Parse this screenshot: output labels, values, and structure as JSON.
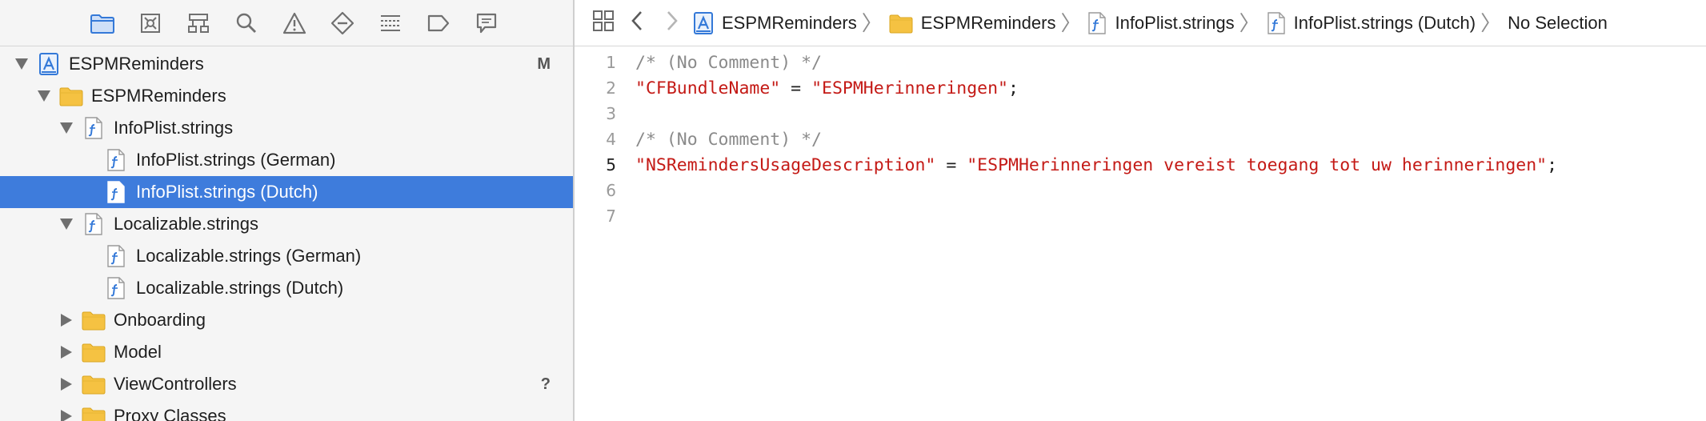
{
  "navigator": {
    "tabs": [
      {
        "name": "project-navigator-tab",
        "icon": "folder-icon",
        "selected": true
      },
      {
        "name": "symbol-navigator-tab",
        "icon": "symbol-icon",
        "selected": false
      },
      {
        "name": "hierarchy-navigator-tab",
        "icon": "hierarchy-icon",
        "selected": false
      },
      {
        "name": "find-navigator-tab",
        "icon": "search-icon",
        "selected": false
      },
      {
        "name": "issue-navigator-tab",
        "icon": "warning-icon",
        "selected": false
      },
      {
        "name": "test-navigator-tab",
        "icon": "diamond-minus-icon",
        "selected": false
      },
      {
        "name": "debug-navigator-tab",
        "icon": "list-icon",
        "selected": false
      },
      {
        "name": "breakpoint-navigator-tab",
        "icon": "breakpoint-icon",
        "selected": false
      },
      {
        "name": "report-navigator-tab",
        "icon": "speech-bubble-icon",
        "selected": false
      }
    ],
    "tree": [
      {
        "label": "ESPMReminders",
        "icon": "project-icon",
        "indent": 0,
        "disclosure": "open",
        "badge": "M"
      },
      {
        "label": "ESPMReminders",
        "icon": "folder-icon",
        "indent": 1,
        "disclosure": "open",
        "badge": ""
      },
      {
        "label": "InfoPlist.strings",
        "icon": "strings-file-icon",
        "indent": 2,
        "disclosure": "open",
        "badge": ""
      },
      {
        "label": "InfoPlist.strings (German)",
        "icon": "strings-file-icon",
        "indent": 3,
        "disclosure": "none",
        "badge": ""
      },
      {
        "label": "InfoPlist.strings (Dutch)",
        "icon": "strings-file-icon",
        "indent": 3,
        "disclosure": "none",
        "badge": "",
        "selected": true
      },
      {
        "label": "Localizable.strings",
        "icon": "strings-file-icon",
        "indent": 2,
        "disclosure": "open",
        "badge": ""
      },
      {
        "label": "Localizable.strings (German)",
        "icon": "strings-file-icon",
        "indent": 3,
        "disclosure": "none",
        "badge": ""
      },
      {
        "label": "Localizable.strings (Dutch)",
        "icon": "strings-file-icon",
        "indent": 3,
        "disclosure": "none",
        "badge": ""
      },
      {
        "label": "Onboarding",
        "icon": "folder-icon",
        "indent": 2,
        "disclosure": "closed",
        "badge": ""
      },
      {
        "label": "Model",
        "icon": "folder-icon",
        "indent": 2,
        "disclosure": "closed",
        "badge": ""
      },
      {
        "label": "ViewControllers",
        "icon": "folder-icon",
        "indent": 2,
        "disclosure": "closed",
        "badge": "?"
      },
      {
        "label": "Proxy Classes",
        "icon": "folder-icon",
        "indent": 2,
        "disclosure": "closed",
        "badge": ""
      }
    ]
  },
  "jumpbar": {
    "related_items_icon": "grid-icon",
    "back_icon": "chevron-left-icon",
    "forward_icon": "chevron-right-icon",
    "crumbs": [
      {
        "label": "ESPMReminders",
        "icon": "project-icon"
      },
      {
        "label": "ESPMReminders",
        "icon": "folder-icon"
      },
      {
        "label": "InfoPlist.strings",
        "icon": "strings-file-icon"
      },
      {
        "label": "InfoPlist.strings (Dutch)",
        "icon": "strings-file-icon"
      },
      {
        "label": "No Selection",
        "icon": ""
      }
    ]
  },
  "editor": {
    "current_line": 5,
    "lines": [
      {
        "number": "1",
        "tokens": [
          {
            "t": "/* (No Comment) */",
            "k": "comment"
          }
        ]
      },
      {
        "number": "2",
        "tokens": [
          {
            "t": "\"CFBundleName\"",
            "k": "string"
          },
          {
            "t": " = ",
            "k": "plain"
          },
          {
            "t": "\"ESPMHerinneringen\"",
            "k": "string"
          },
          {
            "t": ";",
            "k": "plain"
          }
        ]
      },
      {
        "number": "3",
        "tokens": []
      },
      {
        "number": "4",
        "tokens": [
          {
            "t": "/* (No Comment) */",
            "k": "comment"
          }
        ]
      },
      {
        "number": "5",
        "tokens": [
          {
            "t": "\"NSRemindersUsageDescription\"",
            "k": "string"
          },
          {
            "t": " = ",
            "k": "plain"
          },
          {
            "t": "\"ESPMHerinneringen vereist toegang tot uw herinneringen\"",
            "k": "string"
          },
          {
            "t": ";",
            "k": "plain"
          }
        ]
      },
      {
        "number": "6",
        "tokens": []
      },
      {
        "number": "7",
        "tokens": []
      }
    ]
  },
  "colors": {
    "selection": "#3e7cdc",
    "string": "#c41a16",
    "comment": "#8a8a8a",
    "folder": "#f5c242",
    "accent_icon": "#3479d8"
  }
}
